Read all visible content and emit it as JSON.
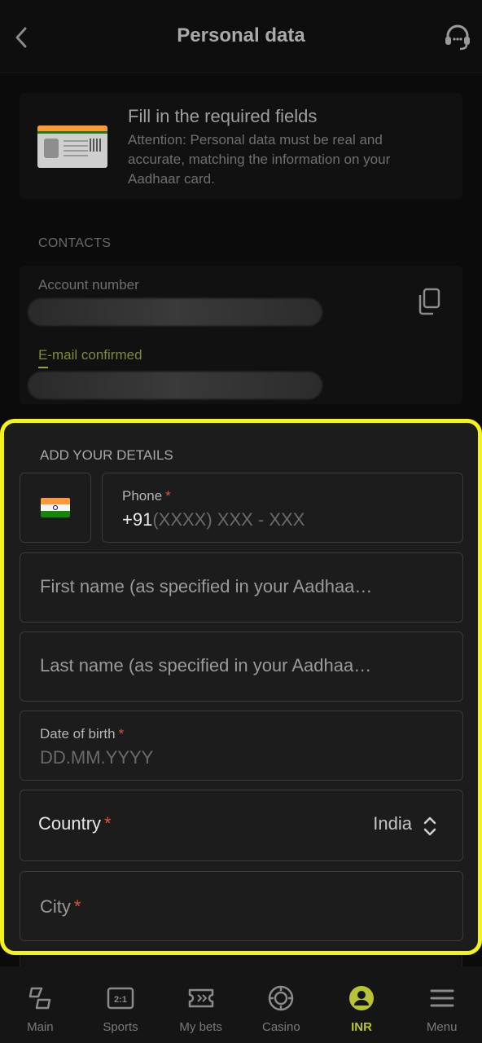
{
  "header": {
    "title": "Personal data"
  },
  "notice": {
    "title": "Fill in the required fields",
    "text": "Attention: Personal data must be real and accurate, matching the information on your Aadhaar card."
  },
  "contacts": {
    "section_label": "CONTACTS",
    "account_label": "Account number",
    "email_label": "E-mail confirmed"
  },
  "form": {
    "section_label": "ADD YOUR DETAILS",
    "phone": {
      "label": "Phone",
      "required": "*",
      "prefix": "+91",
      "placeholder": "(XXXX) XXX - XXX"
    },
    "first_name": {
      "placeholder": "First name (as specified in your Aadhaa…"
    },
    "last_name": {
      "placeholder": "Last name (as specified in your Aadhaa…"
    },
    "dob": {
      "label": "Date of birth",
      "required": "*",
      "placeholder": "DD.MM.YYYY"
    },
    "country": {
      "label": "Country",
      "required": "*",
      "value": "India"
    },
    "city": {
      "label": "City",
      "required": "*"
    }
  },
  "nav": {
    "items": [
      {
        "label": "Main",
        "icon": "main-icon"
      },
      {
        "label": "Sports",
        "icon": "sports-icon"
      },
      {
        "label": "My bets",
        "icon": "ticket-icon"
      },
      {
        "label": "Casino",
        "icon": "casino-chip-icon"
      },
      {
        "label": "INR",
        "icon": "user-icon",
        "active": true
      },
      {
        "label": "Menu",
        "icon": "menu-icon"
      }
    ]
  },
  "colors": {
    "accent": "#b9c434",
    "highlight": "#f5f21a",
    "required": "#e0533a"
  }
}
